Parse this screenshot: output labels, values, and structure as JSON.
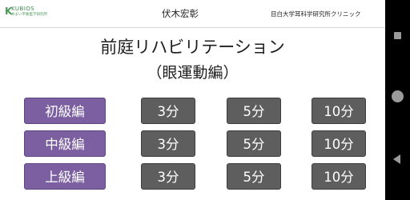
{
  "header": {
    "logo_word": "KUBIOS",
    "logo_sub": "めまい平衡医学研究所",
    "doctor_name": "伏木宏彰",
    "clinic_name": "目白大学耳科学研究所クリニック"
  },
  "main": {
    "title": "前庭リハビリテーション",
    "subtitle": "（眼運動編）",
    "rows": [
      {
        "level": "初級編",
        "times": [
          "3分",
          "5分",
          "10分"
        ]
      },
      {
        "level": "中級編",
        "times": [
          "3分",
          "5分",
          "10分"
        ]
      },
      {
        "level": "上級編",
        "times": [
          "3分",
          "5分",
          "10分"
        ]
      }
    ]
  },
  "colors": {
    "level_button": "#7b5fa0",
    "time_button": "#5e5e5e",
    "navbar": "#000000"
  },
  "navbar": {
    "icons": [
      "recents-icon",
      "home-icon",
      "back-icon"
    ]
  }
}
